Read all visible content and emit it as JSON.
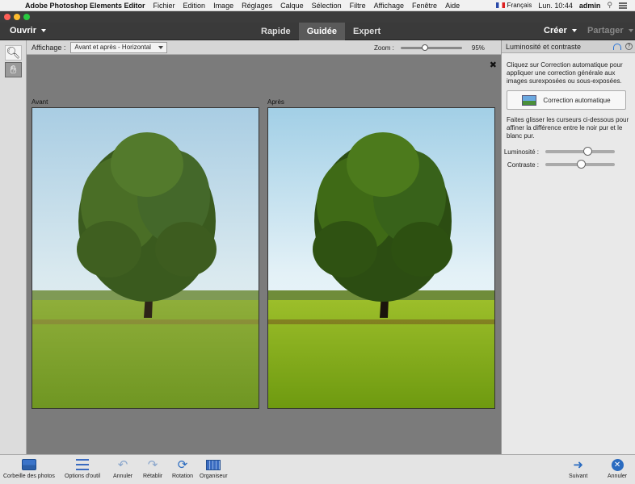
{
  "menubar": {
    "app_name": "Adobe Photoshop Elements Editor",
    "items": [
      "Fichier",
      "Edition",
      "Image",
      "Réglages",
      "Calque",
      "Sélection",
      "Filtre",
      "Affichage",
      "Fenêtre",
      "Aide"
    ],
    "language": "Français",
    "clock": "Lun. 10:44",
    "user": "admin"
  },
  "modebar": {
    "open_label": "Ouvrir",
    "modes": [
      "Rapide",
      "Guidée",
      "Expert"
    ],
    "active_mode": "Guidée",
    "create_label": "Créer",
    "share_label": "Partager"
  },
  "options": {
    "view_label": "Affichage :",
    "view_value": "Avant et après - Horizontal",
    "zoom_label": "Zoom :",
    "zoom_value": "95%",
    "zoom_fraction": 0.38
  },
  "canvas": {
    "before_label": "Avant",
    "after_label": "Après"
  },
  "panel": {
    "title": "Luminosité et contraste",
    "intro_text": "Cliquez sur Correction automatique pour appliquer une correction générale aux images surexposées ou sous-exposées.",
    "auto_button": "Correction automatique",
    "slider_text": "Faites glisser les curseurs ci-dessous pour affiner la différence entre le noir pur et le blanc pur.",
    "brightness_label": "Luminosité :",
    "brightness_fraction": 0.62,
    "contrast_label": "Contraste :",
    "contrast_fraction": 0.52
  },
  "bottombar": {
    "photo_bin": "Corbeille des photos",
    "tool_options": "Options d'outil",
    "undo": "Annuler",
    "redo": "Rétablir",
    "rotate": "Rotation",
    "organizer": "Organiseur",
    "next": "Suivant",
    "cancel": "Annuler"
  },
  "colors": {
    "accent": "#2a6bc0",
    "active_mode_bg": "#5a5a5a"
  }
}
